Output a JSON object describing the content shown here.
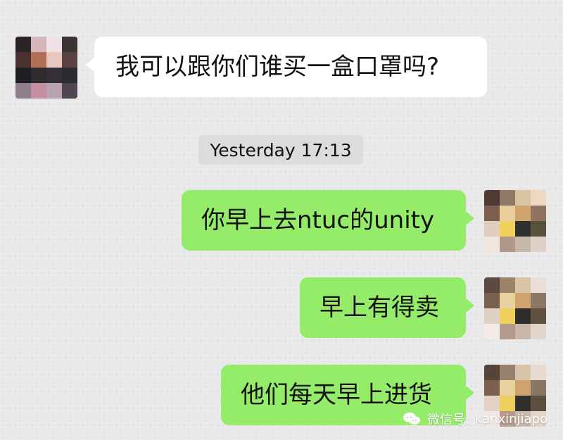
{
  "chat": {
    "incoming": {
      "message": "我可以跟你们谁买一盒口罩吗?"
    },
    "timestamp": "Yesterday 17:13",
    "outgoing": [
      {
        "message": "你早上去ntuc的unity"
      },
      {
        "message": "早上有得卖"
      },
      {
        "message": "他们每天早上进货"
      }
    ]
  },
  "watermark": {
    "label": "微信号:",
    "account": "kanxinjiapo"
  }
}
